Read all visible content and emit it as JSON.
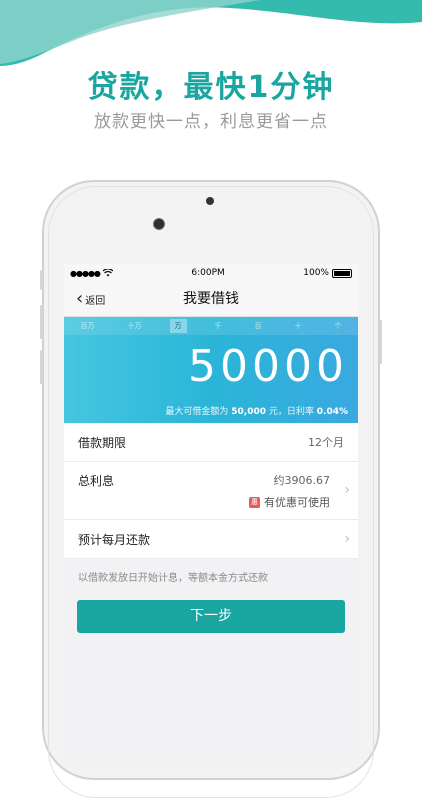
{
  "banner": {
    "headline": "贷款，最快1分钟",
    "subline": "放款更快一点，利息更省一点"
  },
  "statusbar": {
    "time": "6:00PM",
    "battery": "100%"
  },
  "navbar": {
    "back_label": "返回",
    "title": "我要借钱"
  },
  "amount_panel": {
    "units": [
      "百万",
      "十万",
      "万",
      "千",
      "百",
      "十",
      "个"
    ],
    "selected_unit": "万",
    "amount": "50000",
    "limit_prefix": "最大可借金额为",
    "limit_value": "50,000",
    "limit_mid": "元，日利率",
    "rate_value": "0.04%"
  },
  "form": {
    "term_label": "借款期限",
    "term_value": "12个月",
    "interest_label": "总利息",
    "interest_value": "约3906.67",
    "coupon_icon": "惠",
    "coupon_text": "有优惠可使用",
    "monthly_label": "预计每月还款",
    "note": "以借款发放日开始计息，等额本金方式还款",
    "next_button": "下一步"
  },
  "colors": {
    "accent": "#1aa6a0",
    "panel_blue": "#2ab5d8",
    "coupon_red": "#e55a5a"
  }
}
